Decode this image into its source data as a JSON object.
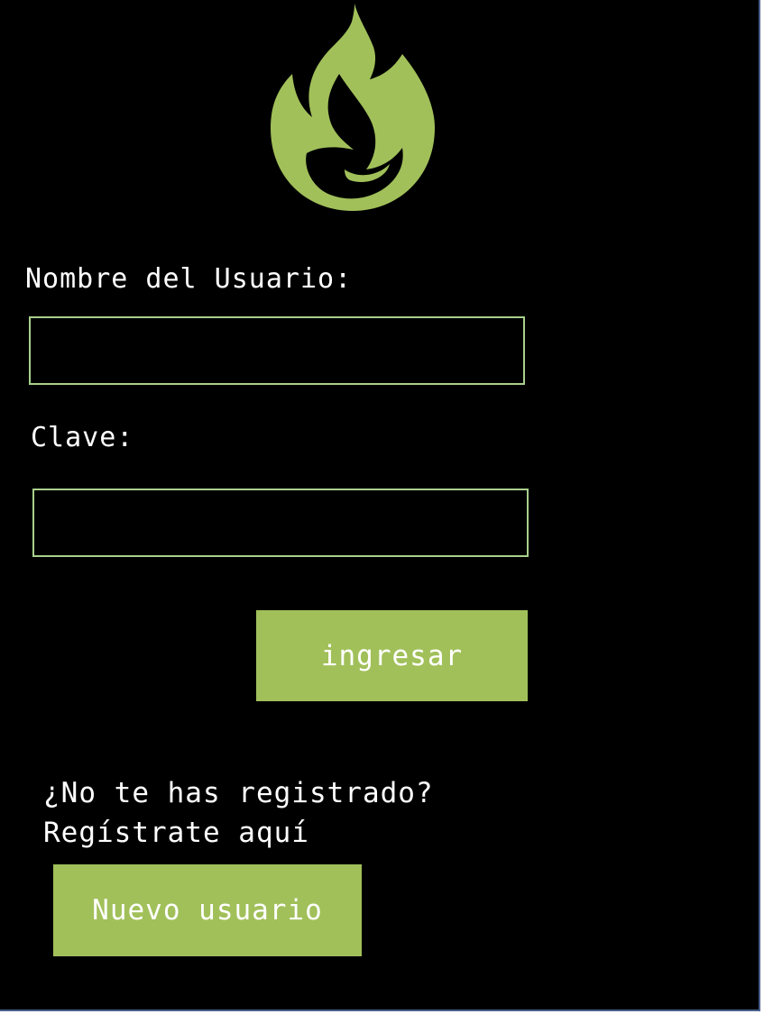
{
  "logo": {
    "icon": "flame-icon",
    "color": "#a1c05a"
  },
  "form": {
    "username_label": "Nombre del Usuario:",
    "username_value": "",
    "password_label": "Clave:",
    "password_value": "",
    "submit_label": "ingresar"
  },
  "register": {
    "question": "¿No te has registrado?",
    "prompt": "Regístrate aquí",
    "button_label": "Nuevo usuario"
  },
  "colors": {
    "background": "#000000",
    "accent": "#a1c05a",
    "field_border": "#a8d08d",
    "text": "#ffffff"
  }
}
